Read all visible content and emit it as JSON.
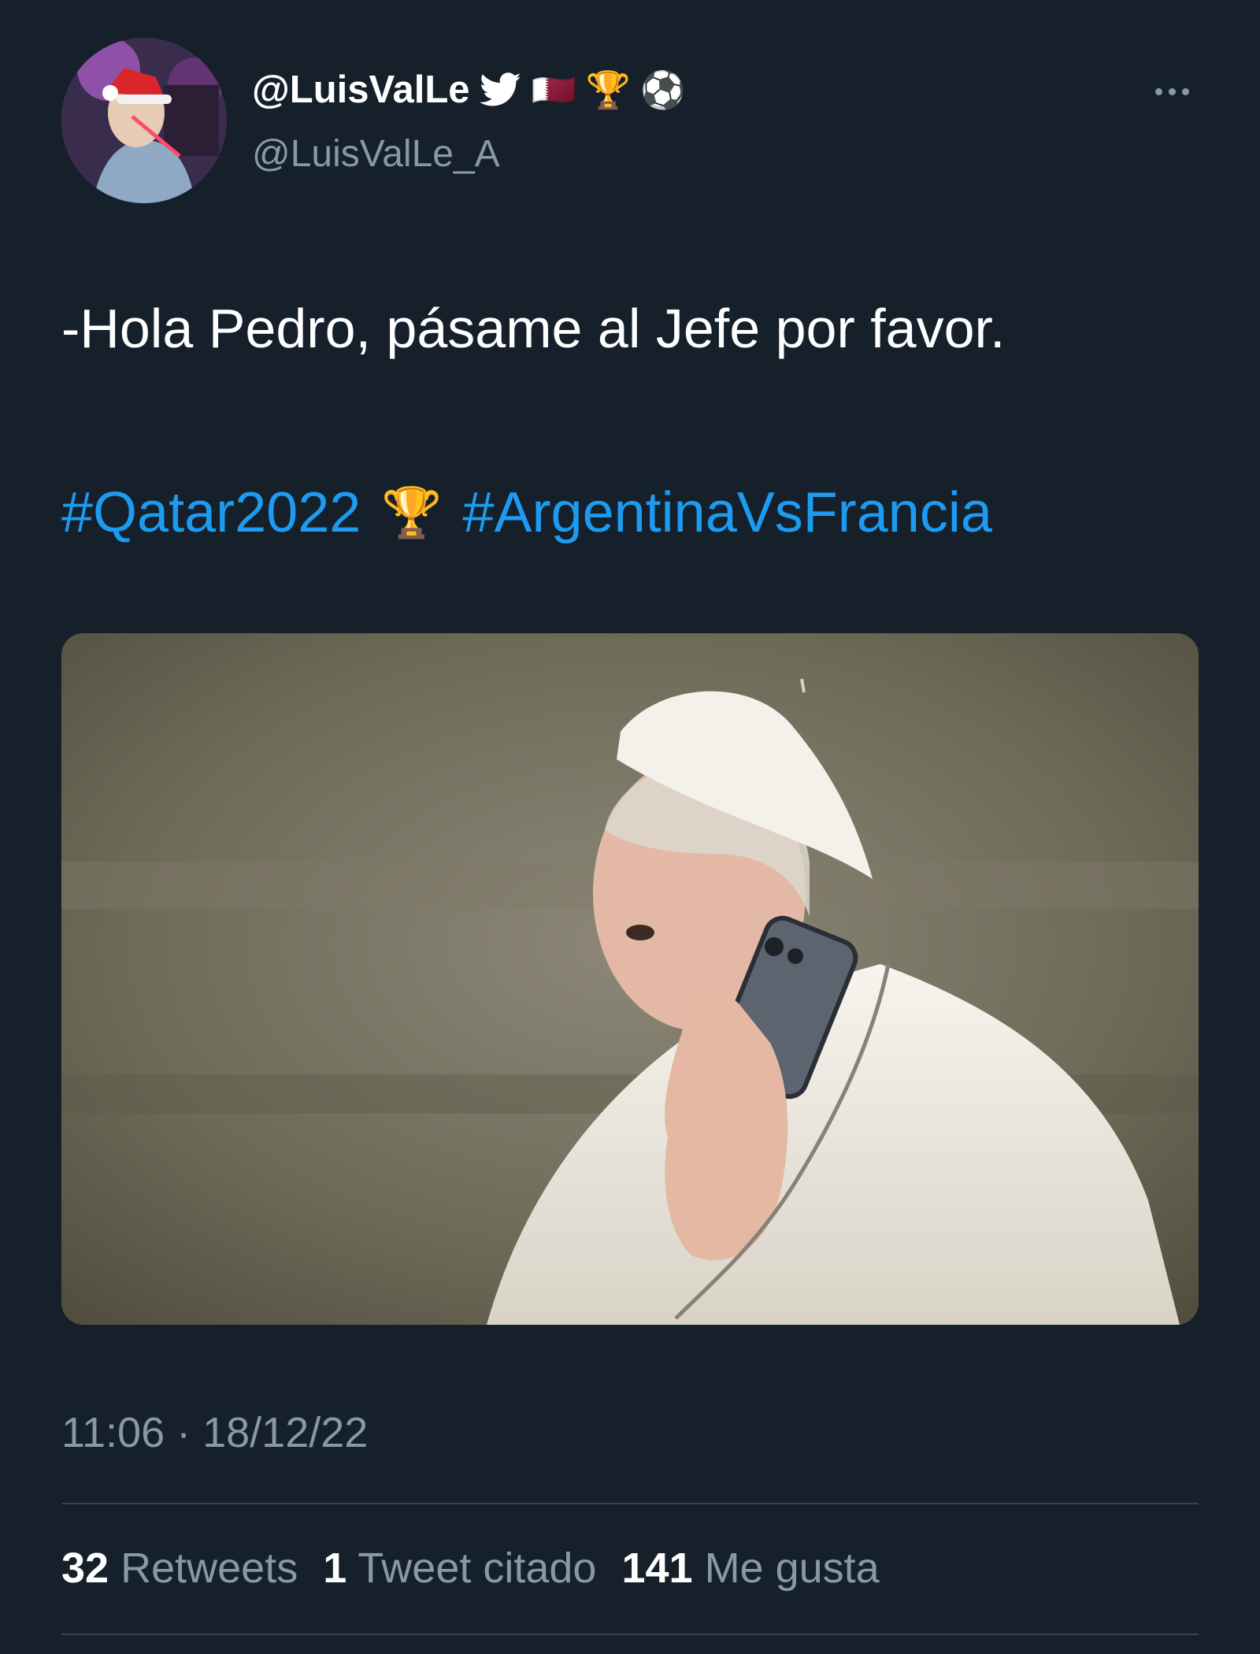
{
  "tweet": {
    "display_name": "@LuisValLe",
    "name_emojis": [
      "🇶🇦",
      "🏆",
      "⚽"
    ],
    "handle": "@LuisValLe_A",
    "text": "-Hola Pedro, pásame al Jefe por favor.",
    "hashtags": [
      "#Qatar2022",
      "#ArgentinaVsFrancia"
    ],
    "hashtag_emoji": "🏆",
    "timestamp": "11:06 · 18/12/22",
    "stats": [
      {
        "count": "32",
        "label": "Retweets"
      },
      {
        "count": "1",
        "label": "Tweet citado"
      },
      {
        "count": "141",
        "label": "Me gusta"
      }
    ]
  },
  "icons": {
    "twitter_bird": "twitter-bird-icon",
    "more": "more-icon"
  },
  "colors": {
    "background": "#15202b",
    "hashtag": "#1d9bf0",
    "secondary_text": "#8899a6",
    "divider": "#38444d"
  }
}
